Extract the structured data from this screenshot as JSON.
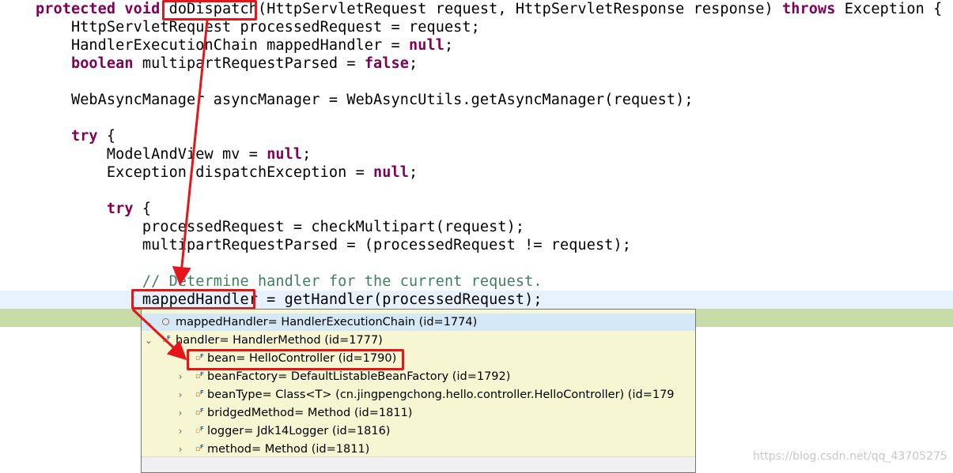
{
  "editor": {
    "lines": [
      {
        "id": "l1",
        "parts": [
          [
            "kw",
            "protected"
          ],
          [
            "t",
            " "
          ],
          [
            "kw",
            "void"
          ],
          [
            "t",
            " doDispatch(HttpServletRequest request, HttpServletResponse response) "
          ],
          [
            "kw",
            "throws"
          ],
          [
            "t",
            " Exception {"
          ]
        ]
      },
      {
        "id": "l2",
        "parts": [
          [
            "t",
            "    HttpServletRequest processedRequest = request;"
          ]
        ]
      },
      {
        "id": "l3",
        "parts": [
          [
            "t",
            "    HandlerExecutionChain mappedHandler = "
          ],
          [
            "kw",
            "null"
          ],
          [
            "t",
            ";"
          ]
        ]
      },
      {
        "id": "l4",
        "parts": [
          [
            "t",
            "    "
          ],
          [
            "kw",
            "boolean"
          ],
          [
            "t",
            " multipartRequestParsed = "
          ],
          [
            "kw",
            "false"
          ],
          [
            "t",
            ";"
          ]
        ]
      },
      {
        "id": "l5",
        "parts": [
          [
            "t",
            ""
          ]
        ]
      },
      {
        "id": "l6",
        "parts": [
          [
            "t",
            "    WebAsyncManager asyncManager = WebAsyncUtils.getAsyncManager(request);"
          ]
        ]
      },
      {
        "id": "l7",
        "parts": [
          [
            "t",
            ""
          ]
        ]
      },
      {
        "id": "l8",
        "parts": [
          [
            "t",
            "    "
          ],
          [
            "kw",
            "try"
          ],
          [
            "t",
            " {"
          ]
        ]
      },
      {
        "id": "l9",
        "parts": [
          [
            "t",
            "        ModelAndView mv = "
          ],
          [
            "kw",
            "null"
          ],
          [
            "t",
            ";"
          ]
        ]
      },
      {
        "id": "l10",
        "parts": [
          [
            "t",
            "        Exception dispatchException = "
          ],
          [
            "kw",
            "null"
          ],
          [
            "t",
            ";"
          ]
        ]
      },
      {
        "id": "l11",
        "parts": [
          [
            "t",
            ""
          ]
        ]
      },
      {
        "id": "l12",
        "parts": [
          [
            "t",
            "        "
          ],
          [
            "kw",
            "try"
          ],
          [
            "t",
            " {"
          ]
        ]
      },
      {
        "id": "l13",
        "parts": [
          [
            "t",
            "            processedRequest = checkMultipart(request);"
          ]
        ]
      },
      {
        "id": "l14",
        "parts": [
          [
            "t",
            "            multipartRequestParsed = (processedRequest != request);"
          ]
        ]
      },
      {
        "id": "l15",
        "parts": [
          [
            "t",
            ""
          ]
        ]
      },
      {
        "id": "l16",
        "parts": [
          [
            "cm",
            "            // Determine handler for the current request."
          ]
        ]
      },
      {
        "id": "l17",
        "parts": [
          [
            "t",
            "            mappedHandler = getHandler(processedRequest);"
          ]
        ]
      },
      {
        "id": "l18",
        "parts": [
          [
            "t",
            "                                                                     {"
          ]
        ]
      },
      {
        "id": "l19",
        "parts": [
          [
            "t",
            ""
          ]
        ]
      },
      {
        "id": "l20",
        "parts": [
          [
            "t",
            ""
          ]
        ]
      },
      {
        "id": "l21",
        "parts": [
          [
            "t",
            ""
          ]
        ]
      },
      {
        "id": "l22",
        "parts": [
          [
            "t",
            ""
          ]
        ]
      },
      {
        "id": "l23",
        "parts": [
          [
            "t",
            ""
          ]
        ]
      },
      {
        "id": "l24",
        "parts": [
          [
            "t",
            "                                                                     );"
          ]
        ]
      }
    ]
  },
  "inspect_popup": {
    "rows": [
      {
        "twisty": "v",
        "icon": "object-icon",
        "label": "mappedHandler= HandlerExecutionChain  (id=1774)",
        "selected": true
      },
      {
        "twisty": "v",
        "icon": "field-icon",
        "label": "handler= HandlerMethod  (id=1777)",
        "selected": false
      },
      {
        "twisty": "",
        "icon": "field-icon",
        "label": "bean= HelloController  (id=1790)",
        "selected": false
      },
      {
        "twisty": ">",
        "icon": "field-icon",
        "label": "beanFactory= DefaultListableBeanFactory  (id=1792)",
        "selected": false
      },
      {
        "twisty": ">",
        "icon": "field-icon",
        "label": "beanType= Class<T> (cn.jingpengchong.hello.controller.HelloController) (id=179",
        "selected": false
      },
      {
        "twisty": ">",
        "icon": "field-icon",
        "label": "bridgedMethod= Method  (id=1811)",
        "selected": false
      },
      {
        "twisty": ">",
        "icon": "static-field-icon",
        "label": "logger= Jdk14Logger  (id=1816)",
        "selected": false
      },
      {
        "twisty": ">",
        "icon": "field-icon",
        "label": "method= Method  (id=1811)",
        "selected": false
      }
    ]
  },
  "annotation_color": "#e3161a",
  "keyword_color": "#7f0055",
  "comment_color": "#3f7f5f",
  "watermark": "https://blog.csdn.net/qq_43705275"
}
